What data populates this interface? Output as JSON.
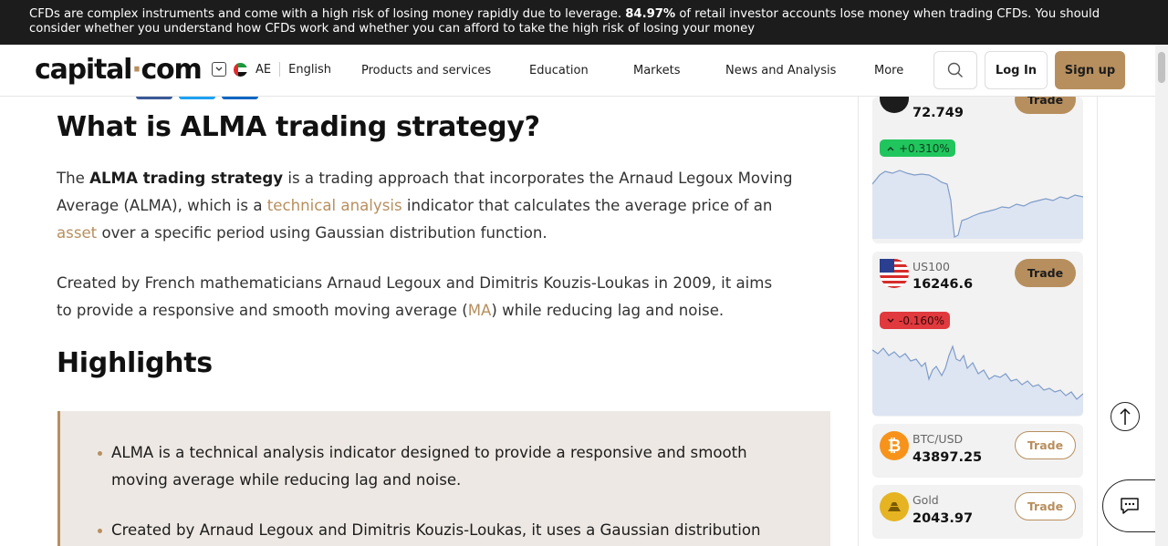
{
  "risk_banner": {
    "text_before": "CFDs are complex instruments and come with a high risk of losing money rapidly due to leverage. ",
    "percent": "84.97%",
    "text_after": " of retail investor accounts lose money when trading CFDs. You should consider whether you understand how CFDs work and whether you can afford to take the high risk of losing your money"
  },
  "header": {
    "logo_main": "capital",
    "logo_dot": "·",
    "logo_end": "com",
    "region_code": "AE",
    "language": "English",
    "nav": [
      "Products and services",
      "Education",
      "Markets",
      "News and Analysis",
      "More"
    ],
    "login": "Log In",
    "signup": "Sign up"
  },
  "article": {
    "title": "What is ALMA trading strategy?",
    "p1": {
      "t1": "The ",
      "bold": "ALMA trading strategy",
      "t2": " is a trading approach that incorporates the Arnaud Legoux Moving Average (ALMA), which is a ",
      "link1": "technical analysis",
      "t3": " indicator that calculates the average price of an ",
      "link2": "asset",
      "t4": " over a specific period using Gaussian distribution function."
    },
    "p2": {
      "t1": "Created by French mathematicians Arnaud Legoux and Dimitris Kouzis-Loukas in 2009, it aims to provide a responsive and smooth moving average (",
      "link": "MA",
      "t2": ") while reducing lag and noise."
    },
    "highlights_title": "Highlights",
    "highlights": [
      "ALMA is a technical analysis indicator designed to provide a responsive and smooth moving average while reducing lag and noise.",
      "Created by Arnaud Legoux and Dimitris Kouzis-Loukas, it uses a Gaussian distribution"
    ]
  },
  "sidebar": {
    "cards": [
      {
        "symbol": "",
        "price": "72.749",
        "change": "+0.310%",
        "direction": "up",
        "trade": "Trade"
      },
      {
        "symbol": "US100",
        "price": "16246.6",
        "change": "-0.160%",
        "direction": "down",
        "trade": "Trade"
      },
      {
        "symbol": "BTC/USD",
        "price": "43897.25",
        "trade": "Trade"
      },
      {
        "symbol": "Gold",
        "price": "2043.97",
        "trade": "Trade"
      }
    ]
  },
  "colors": {
    "accent": "#b78f5e",
    "up": "#21c55d",
    "down": "#e0393e"
  }
}
